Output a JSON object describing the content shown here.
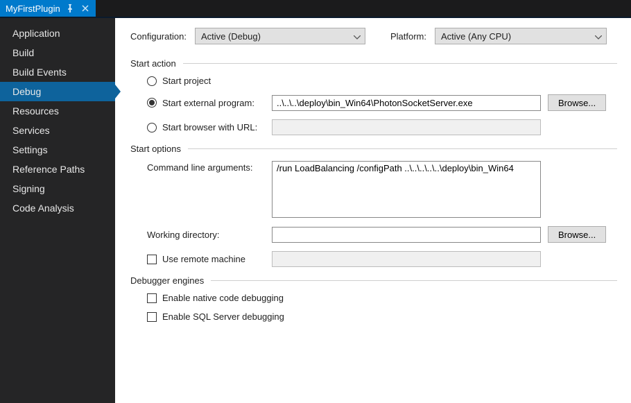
{
  "tab": {
    "title": "MyFirstPlugin"
  },
  "sidebar": {
    "items": [
      {
        "label": "Application"
      },
      {
        "label": "Build"
      },
      {
        "label": "Build Events"
      },
      {
        "label": "Debug",
        "selected": true
      },
      {
        "label": "Resources"
      },
      {
        "label": "Services"
      },
      {
        "label": "Settings"
      },
      {
        "label": "Reference Paths"
      },
      {
        "label": "Signing"
      },
      {
        "label": "Code Analysis"
      }
    ]
  },
  "top": {
    "configuration_label": "Configuration:",
    "configuration_value": "Active (Debug)",
    "platform_label": "Platform:",
    "platform_value": "Active (Any CPU)"
  },
  "sections": {
    "start_action": "Start action",
    "start_options": "Start options",
    "debugger_engines": "Debugger engines"
  },
  "start_action": {
    "start_project": "Start project",
    "start_external": "Start external program:",
    "external_path": "..\\..\\..\\deploy\\bin_Win64\\PhotonSocketServer.exe",
    "browse": "Browse...",
    "start_browser": "Start browser with URL:",
    "browser_url": ""
  },
  "start_options": {
    "cmd_args_label": "Command line arguments:",
    "cmd_args_value": "/run LoadBalancing /configPath ..\\..\\..\\..\\..\\deploy\\bin_Win64",
    "working_dir_label": "Working directory:",
    "working_dir_value": "",
    "browse": "Browse...",
    "use_remote": "Use remote machine",
    "remote_value": ""
  },
  "debugger": {
    "enable_native": "Enable native code debugging",
    "enable_sql": "Enable SQL Server debugging"
  }
}
